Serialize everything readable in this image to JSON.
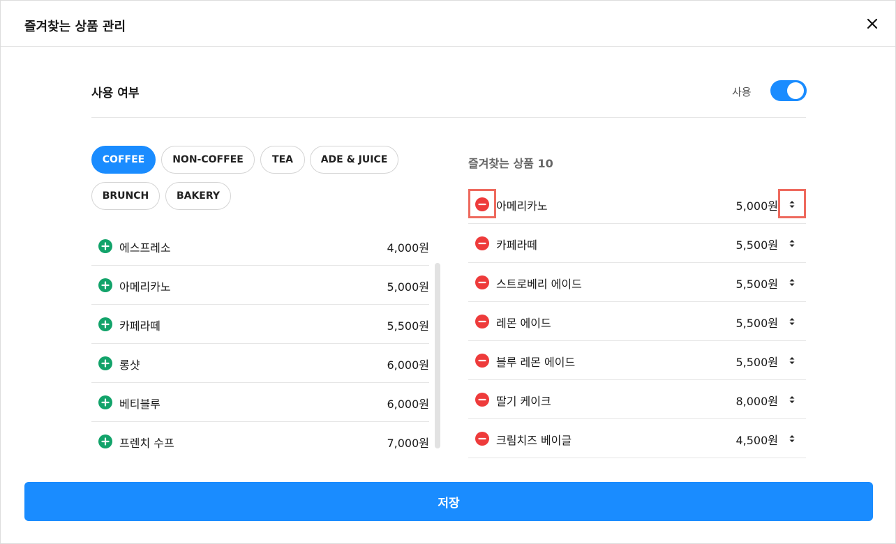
{
  "header": {
    "title": "즐겨찾는 상품 관리"
  },
  "usage": {
    "label": "사용 여부",
    "state_label": "사용",
    "enabled": true
  },
  "categories": [
    {
      "label": "COFFEE",
      "active": true
    },
    {
      "label": "NON-COFFEE",
      "active": false
    },
    {
      "label": "TEA",
      "active": false
    },
    {
      "label": "ADE & JUICE",
      "active": false
    },
    {
      "label": "BRUNCH",
      "active": false
    },
    {
      "label": "BAKERY",
      "active": false
    }
  ],
  "menu_items": [
    {
      "name": "에스프레소",
      "price": "4,000원"
    },
    {
      "name": "아메리카노",
      "price": "5,000원"
    },
    {
      "name": "카페라떼",
      "price": "5,500원"
    },
    {
      "name": "롱샷",
      "price": "6,000원"
    },
    {
      "name": "베티블루",
      "price": "6,000원"
    },
    {
      "name": "프렌치 수프",
      "price": "7,000원"
    }
  ],
  "favorites": {
    "title": "즐겨찾는 상품 10",
    "items": [
      {
        "name": "아메리카노",
        "price": "5,000원"
      },
      {
        "name": "카페라떼",
        "price": "5,500원"
      },
      {
        "name": "스트로베리 에이드",
        "price": "5,500원"
      },
      {
        "name": "레몬 에이드",
        "price": "5,500원"
      },
      {
        "name": "블루 레몬 에이드",
        "price": "5,500원"
      },
      {
        "name": "딸기 케이크",
        "price": "8,000원"
      },
      {
        "name": "크림치즈 베이글",
        "price": "4,500원"
      }
    ]
  },
  "save_label": "저장",
  "icons": {
    "close": "close-icon",
    "add": "plus-circle-icon",
    "remove": "minus-circle-icon",
    "reorder": "sort-handle-icon"
  },
  "colors": {
    "primary": "#1a8cff",
    "add": "#12a36a",
    "remove": "#ee3b3b",
    "highlight": "#ee6a5e"
  }
}
